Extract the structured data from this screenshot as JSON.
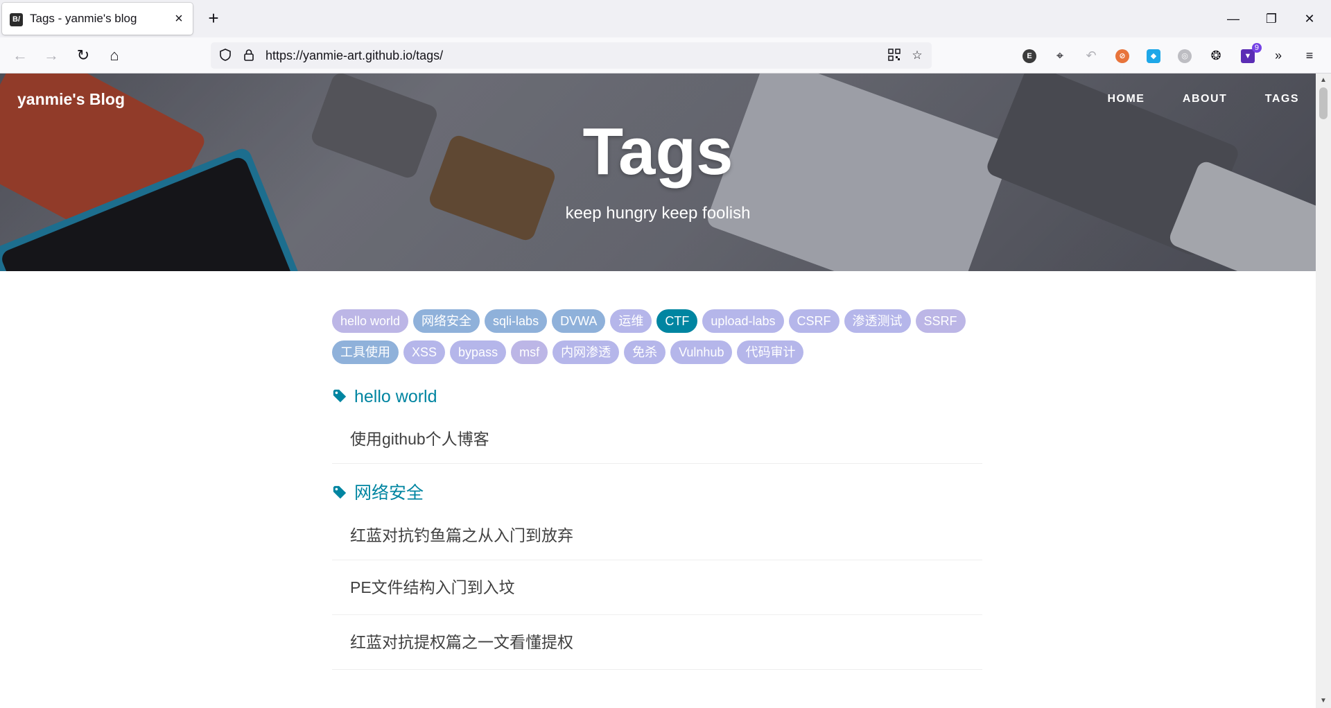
{
  "browser": {
    "tab_title": "Tags - yanmie's blog",
    "tab_favicon_text": "B/",
    "tab_close": "×",
    "new_tab": "+",
    "url": "https://yanmie-art.github.io/tags/",
    "extension_badge": "9",
    "extension_e": "E"
  },
  "site": {
    "brand": "yanmie's Blog",
    "nav": [
      "HOME",
      "ABOUT",
      "TAGS"
    ],
    "hero_title": "Tags",
    "hero_subtitle": "keep hungry keep foolish"
  },
  "tags": [
    {
      "label": "hello world",
      "color": "#bcb6e6"
    },
    {
      "label": "网络安全",
      "color": "#8fb1da"
    },
    {
      "label": "sqli-labs",
      "color": "#8fb1da"
    },
    {
      "label": "DVWA",
      "color": "#8fb1da"
    },
    {
      "label": "运维",
      "color": "#b5b6ea"
    },
    {
      "label": "CTF",
      "color": "#0085a1"
    },
    {
      "label": "upload-labs",
      "color": "#b5b6ea"
    },
    {
      "label": "CSRF",
      "color": "#b5b6ea"
    },
    {
      "label": "渗透测试",
      "color": "#b5b6ea"
    },
    {
      "label": "SSRF",
      "color": "#bcb6e6"
    },
    {
      "label": "工具使用",
      "color": "#8fb1da"
    },
    {
      "label": "XSS",
      "color": "#b5b6ea"
    },
    {
      "label": "bypass",
      "color": "#b5b6ea"
    },
    {
      "label": "msf",
      "color": "#bcb6e6"
    },
    {
      "label": "内网渗透",
      "color": "#b5b6ea"
    },
    {
      "label": "免杀",
      "color": "#b5b6ea"
    },
    {
      "label": "Vulnhub",
      "color": "#b5b6ea"
    },
    {
      "label": "代码审计",
      "color": "#b5b6ea"
    }
  ],
  "sections": [
    {
      "title": "hello world",
      "posts": [
        "使用github个人博客"
      ]
    },
    {
      "title": "网络安全",
      "posts": [
        "红蓝对抗钓鱼篇之从入门到放弃",
        "PE文件结构入门到入坟",
        "红蓝对抗提权篇之一文看懂提权"
      ]
    }
  ]
}
